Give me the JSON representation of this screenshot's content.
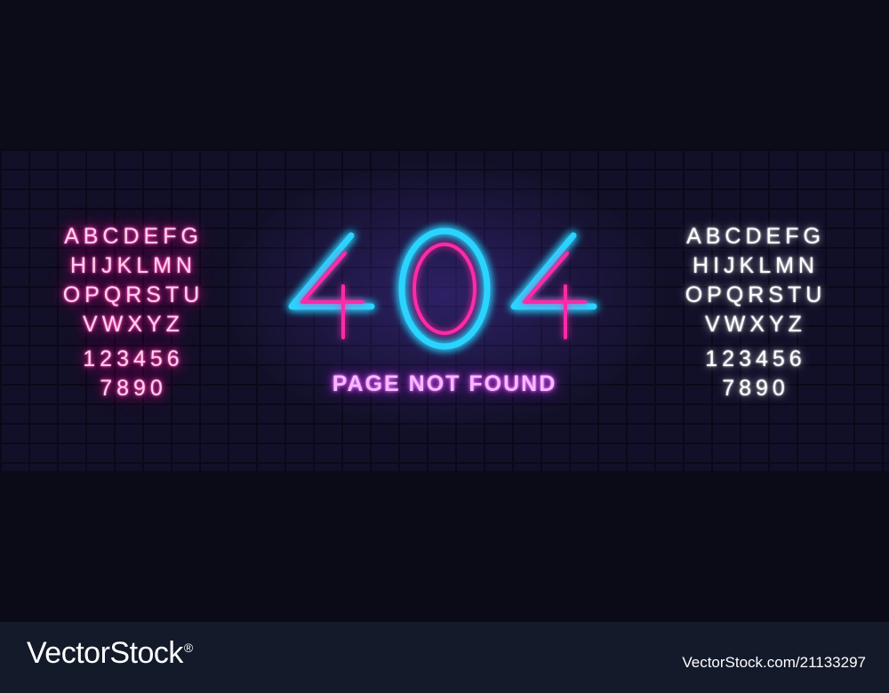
{
  "sign": {
    "code": "404",
    "tagline": "PAGE NOT FOUND"
  },
  "alphabet_pink": {
    "rows": [
      "ABCDEFG",
      "HIJKLMN",
      "OPQRSTU",
      "VWXYZ",
      "123456",
      "7890"
    ]
  },
  "alphabet_white": {
    "rows": [
      "ABCDEFG",
      "HIJKLMN",
      "OPQRSTU",
      "VWXYZ",
      "123456",
      "7890"
    ]
  },
  "footer": {
    "brand": "VectorStock",
    "registered": "®",
    "image_id": "VectorStock.com/21133297"
  },
  "colors": {
    "background": "#0b0a17",
    "neon_blue": "#2ad4ff",
    "neon_pink": "#ff2aa8",
    "neon_violet": "#d23cf0",
    "neon_white": "#ffffff",
    "footer_bar": "#131a2a"
  }
}
